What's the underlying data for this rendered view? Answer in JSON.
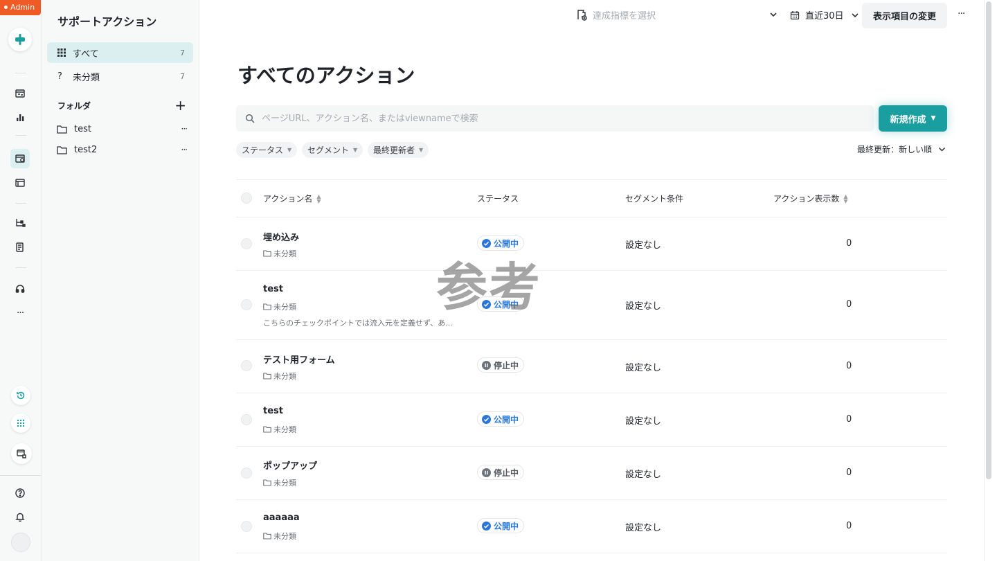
{
  "admin_badge": "Admin",
  "sidebar": {
    "title": "サポートアクション",
    "nav": [
      {
        "label": "すべて",
        "count": "7",
        "icon": "grid-icon"
      },
      {
        "label": "未分類",
        "count": "7",
        "icon": "question-icon"
      }
    ],
    "folders_heading": "フォルダ",
    "folders": [
      {
        "label": "test",
        "more": "···"
      },
      {
        "label": "test2",
        "more": "···"
      }
    ]
  },
  "topbar": {
    "goal_placeholder": "達成指標を選択",
    "date_range": "直近30日",
    "display_button": "表示項目の変更",
    "more": "···"
  },
  "page_title": "すべてのアクション",
  "search": {
    "placeholder": "ページURL、アクション名、またはviewnameで検索"
  },
  "new_button": "新規作成",
  "filters": [
    "ステータス",
    "セグメント",
    "最終更新者"
  ],
  "sort_label": "最終更新：新しい順",
  "table": {
    "headers": {
      "name": "アクション名",
      "status": "ステータス",
      "segment": "セグメント条件",
      "count": "アクション表示数"
    },
    "rows": [
      {
        "name": "埋め込み",
        "folder": "未分類",
        "status": "公開中",
        "status_kind": "live",
        "segment": "設定なし",
        "count": "0",
        "desc": ""
      },
      {
        "name": "test",
        "folder": "未分類",
        "status": "公開中",
        "status_kind": "live",
        "segment": "設定なし",
        "count": "0",
        "desc": "こちらのチェックポイントでは流入元を定義せず、あ..."
      },
      {
        "name": "テスト用フォーム",
        "folder": "未分類",
        "status": "停止中",
        "status_kind": "stop",
        "segment": "設定なし",
        "count": "0",
        "desc": ""
      },
      {
        "name": "test",
        "folder": "未分類",
        "status": "公開中",
        "status_kind": "live",
        "segment": "設定なし",
        "count": "0",
        "desc": ""
      },
      {
        "name": "ポップアップ",
        "folder": "未分類",
        "status": "停止中",
        "status_kind": "stop",
        "segment": "設定なし",
        "count": "0",
        "desc": ""
      },
      {
        "name": "aaaaaa",
        "folder": "未分類",
        "status": "公開中",
        "status_kind": "live",
        "segment": "設定なし",
        "count": "0",
        "desc": ""
      }
    ]
  },
  "watermark": "参考",
  "colors": {
    "accent": "#1a9ea0",
    "live": "#2a77d8",
    "admin": "#f05a24"
  }
}
